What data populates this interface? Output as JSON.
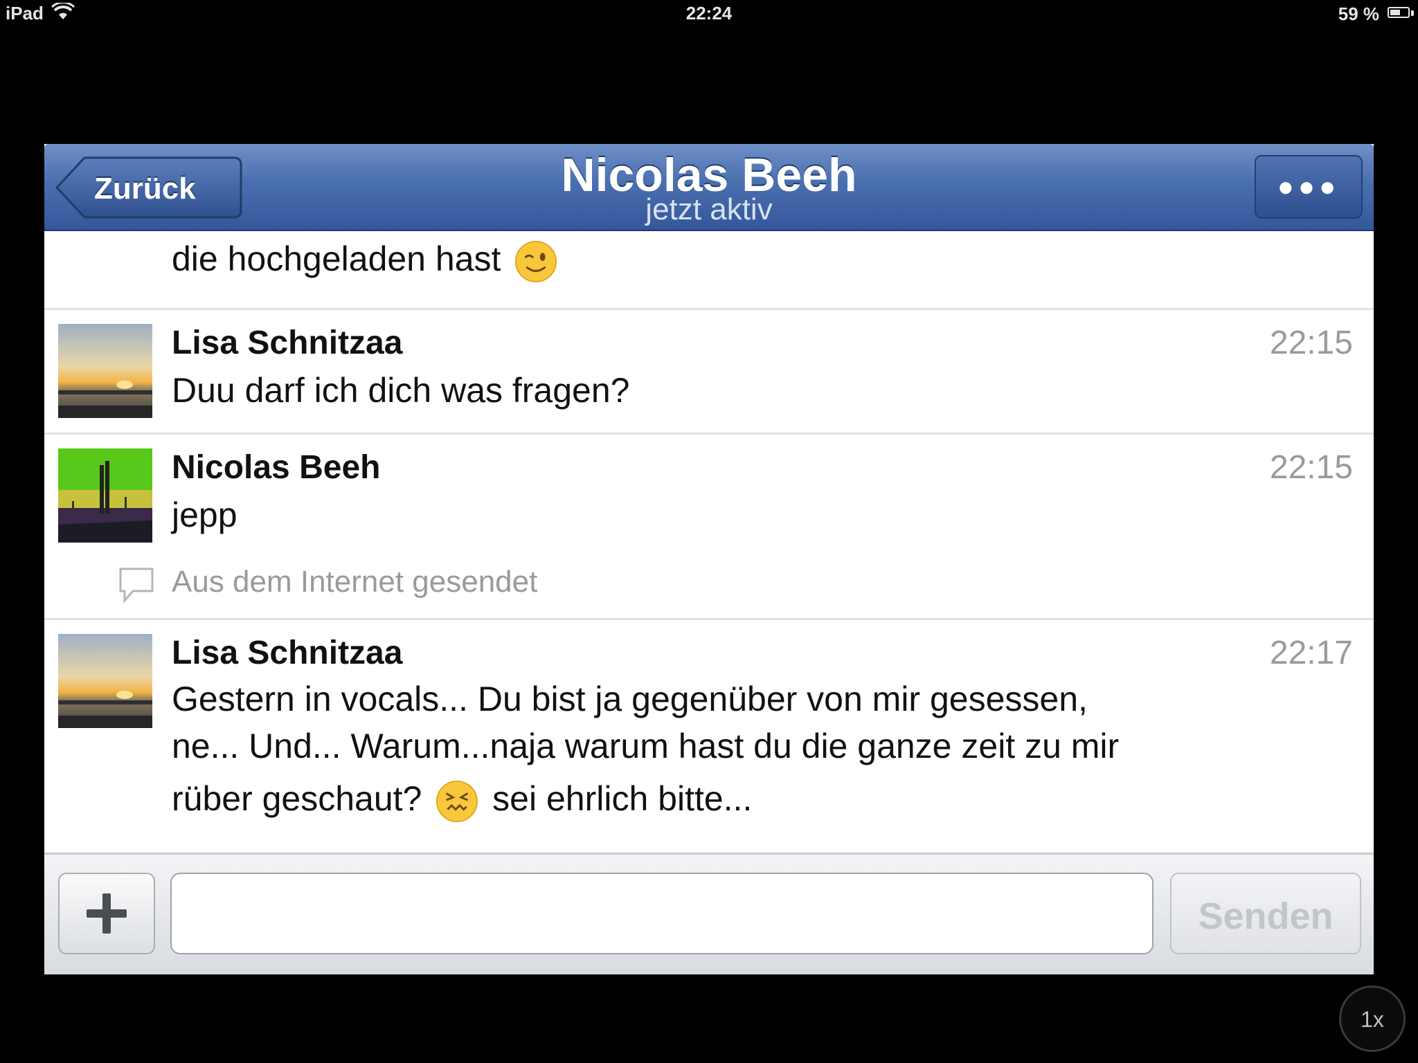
{
  "status_bar": {
    "device": "iPad",
    "time": "22:24",
    "battery_text": "59 %",
    "battery_level": 0.59
  },
  "nav": {
    "back_label": "Zurück",
    "title": "Nicolas Beeh",
    "subtitle": "jetzt aktiv",
    "more_icon": "ellipsis-icon"
  },
  "messages": [
    {
      "text_before_emoji": "die hochgeladen hast",
      "emoji": "winking-face"
    },
    {
      "sender": "Lisa Schnitzaa",
      "time": "22:15",
      "text": "Duu darf ich dich was fragen?"
    },
    {
      "sender": "Nicolas Beeh",
      "time": "22:15",
      "text": "jepp",
      "via": "Aus dem Internet gesendet"
    },
    {
      "sender": "Lisa Schnitzaa",
      "time": "22:17",
      "line1": "Gestern in vocals... Du bist ja gegenüber von mir gesessen,",
      "line2": "ne... Und... Warum...naja warum hast du die ganze zeit zu mir",
      "line3_before_emoji": "rüber geschaut?",
      "emoji": "confounded-face",
      "line3_after_emoji": "sei ehrlich bitte..."
    }
  ],
  "compose": {
    "input_value": "",
    "send_label": "Senden",
    "add_icon": "plus-icon"
  },
  "zoom_label": "1x",
  "colors": {
    "nav_blue": "#3b5998",
    "meta_gray": "#9a9a9a"
  }
}
